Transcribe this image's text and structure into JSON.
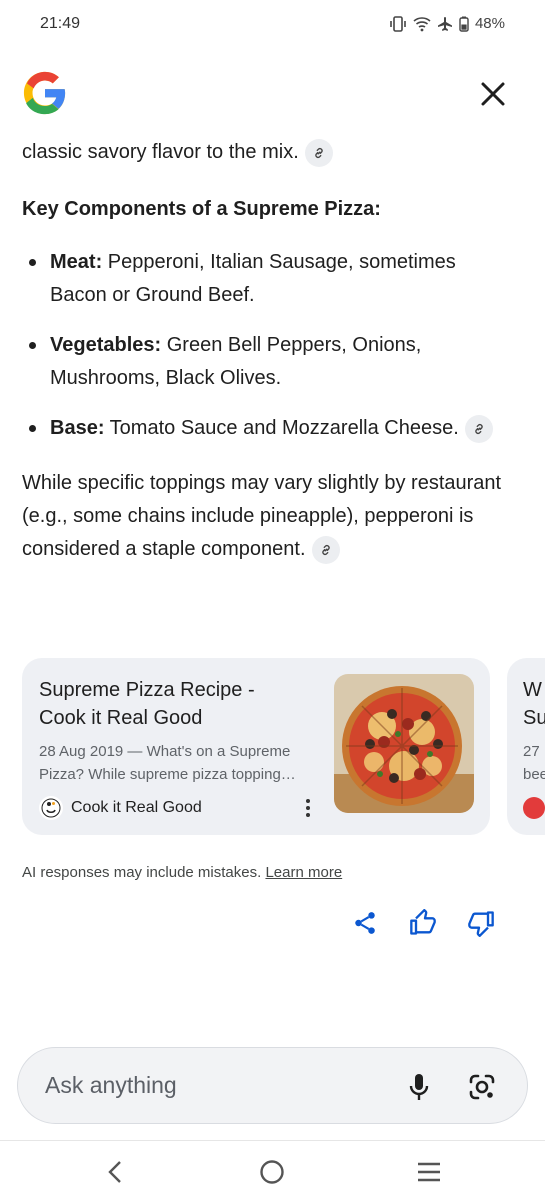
{
  "status_bar": {
    "time": "21:49",
    "battery": "48%",
    "icons": [
      "vibrate-icon",
      "wifi-icon",
      "airplane-icon",
      "battery-icon"
    ]
  },
  "header": {
    "logo": "google-g-logo",
    "close_icon": "close-icon"
  },
  "answer": {
    "intro_fragment": "classic savory flavor to the mix.",
    "heading": "Key Components of a Supreme Pizza:",
    "bullets": [
      {
        "label": "Meat:",
        "text": " Pepperoni, Italian Sausage, sometimes Bacon or Ground Beef."
      },
      {
        "label": "Vegetables:",
        "text": " Green Bell Peppers, Onions, Mushrooms, Black Olives."
      },
      {
        "label": "Base:",
        "text": " Tomato Sauce and Mozzarella Cheese."
      }
    ],
    "closing": "While specific toppings may vary slightly by restaurant (e.g., some chains include pineapple), pepperoni is considered a staple component."
  },
  "cards": [
    {
      "title_line1": "Supreme Pizza Recipe -",
      "title_line2": "Cook it Real Good",
      "snippet_line1": "28 Aug 2019 — What's on a Supreme",
      "snippet_line2": "Pizza? While supreme pizza topping…",
      "source": "Cook it Real Good"
    },
    {
      "title_line1": "W",
      "title_line2": "Su",
      "snippet_line1": "27",
      "snippet_line2": "bee"
    }
  ],
  "disclaimer": {
    "text": "AI responses may include mistakes.",
    "link": "Learn more"
  },
  "ask_bar": {
    "placeholder": "Ask anything"
  },
  "colors": {
    "accent_blue": "#0b57d0",
    "card_bg": "#eef0f4",
    "text": "#1f1f1f"
  }
}
